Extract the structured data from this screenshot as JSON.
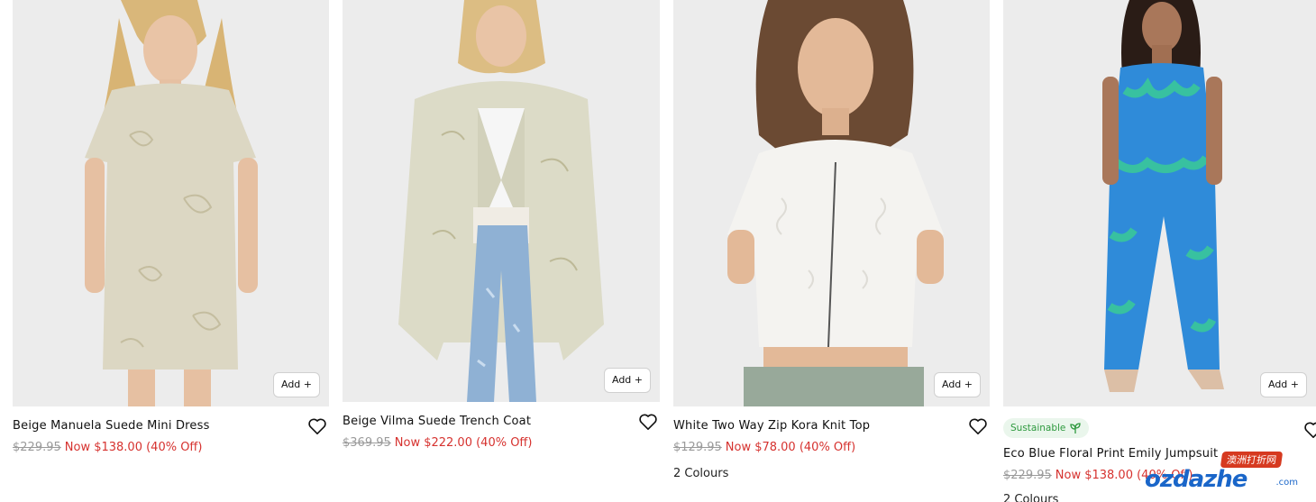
{
  "products": [
    {
      "title": "Beige Manuela Suede Mini Dress",
      "original_price": "$229.95",
      "sale_price": "Now $138.00 (40% Off)",
      "add_label": "Add +",
      "image_icon": "dress-photo"
    },
    {
      "title": "Beige Vilma Suede Trench Coat",
      "original_price": "$369.95",
      "sale_price": "Now $222.00 (40% Off)",
      "add_label": "Add +",
      "image_icon": "coat-photo"
    },
    {
      "title": "White Two Way Zip Kora Knit Top",
      "original_price": "$129.95",
      "sale_price": "Now $78.00 (40% Off)",
      "colours": "2 Colours",
      "add_label": "Add +",
      "image_icon": "top-photo"
    },
    {
      "title": "Eco Blue Floral Print Emily Jumpsuit",
      "badge": "Sustainable",
      "original_price": "$229.95",
      "sale_price": "Now $138.00 (40% Off)",
      "colours": "2 Colours",
      "add_label": "Add +",
      "image_icon": "jumpsuit-photo"
    }
  ],
  "watermark": {
    "top": "澳洲打折网",
    "main": "ozdazhe",
    "sub": ".com"
  },
  "colors": {
    "sale": "#d6322f",
    "original": "#9a9a9a",
    "badge_text": "#2f9a3f",
    "badge_bg": "#eaf6ec"
  }
}
